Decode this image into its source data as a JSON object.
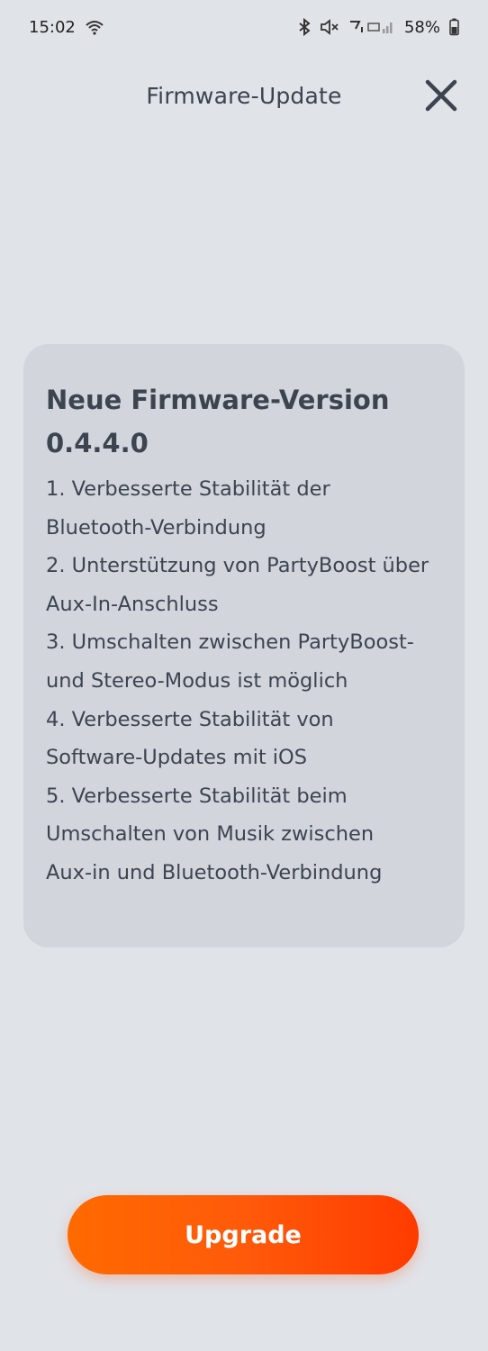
{
  "status_bar": {
    "time": "15:02",
    "battery": "58%",
    "icons": [
      "wifi-icon",
      "bluetooth-icon",
      "mute-icon",
      "signal-icon",
      "battery-icon"
    ]
  },
  "header": {
    "title": "Firmware-Update",
    "close_icon": "close-icon"
  },
  "card": {
    "title": "Neue Firmware-Version 0.4.4.0",
    "notes": [
      "1. Verbesserte Stabilität der\nBluetooth-Verbindung",
      "2. Unterstützung von PartyBoost über\nAux-In-Anschluss",
      "3. Umschalten zwischen PartyBoost-\nund Stereo-Modus ist möglich",
      "4. Verbesserte Stabilität von\nSoftware-Updates mit iOS",
      "5. Verbesserte Stabilität beim\nUmschalten von Musik zwischen\nAux-in und Bluetooth-Verbindung"
    ]
  },
  "button": {
    "label": "Upgrade"
  },
  "colors": {
    "background": "#e0e3e8",
    "card": "#d2d6dc",
    "text": "#3c4450",
    "accent_start": "#ff6a00",
    "accent_end": "#ff3b00"
  }
}
